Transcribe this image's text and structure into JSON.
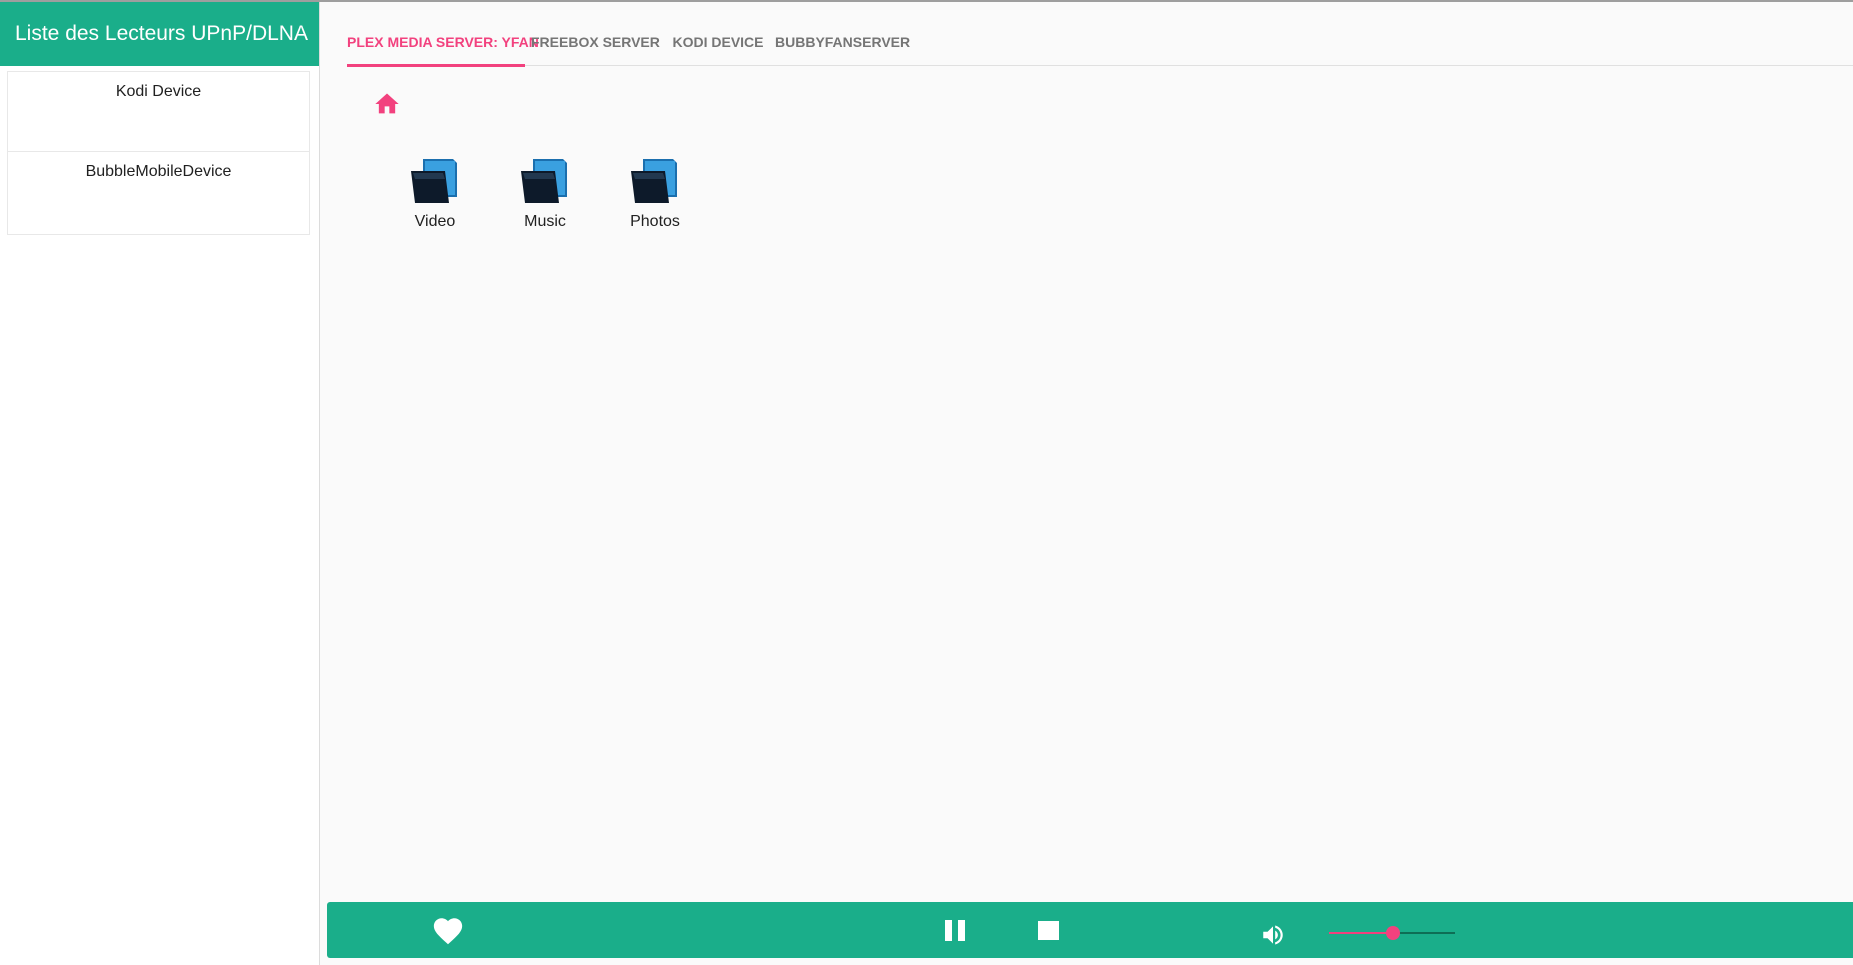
{
  "sidebar": {
    "title": "Liste des Lecteurs UPnP/DLNA",
    "devices": [
      {
        "label": "Kodi Device"
      },
      {
        "label": "BubbleMobileDevice"
      }
    ]
  },
  "tabs": [
    {
      "label": "PLEX MEDIA SERVER: YFAN",
      "active": true
    },
    {
      "label": "FREEBOX SERVER",
      "active": false
    },
    {
      "label": "KODI DEVICE",
      "active": false
    },
    {
      "label": "BUBBYFANSERVER",
      "active": false
    }
  ],
  "browser": {
    "home_icon": "home-icon",
    "folders": [
      {
        "label": "Video",
        "icon": "folder-icon"
      },
      {
        "label": "Music",
        "icon": "folder-icon"
      },
      {
        "label": "Photos",
        "icon": "folder-icon"
      }
    ]
  },
  "player": {
    "favorite_icon": "heart-icon",
    "pause_icon": "pause-icon",
    "stop_icon": "stop-icon",
    "volume_icon": "volume-icon",
    "volume_level": 0.5
  },
  "colors": {
    "primary": "#1aae8a",
    "accent": "#f2417e"
  }
}
